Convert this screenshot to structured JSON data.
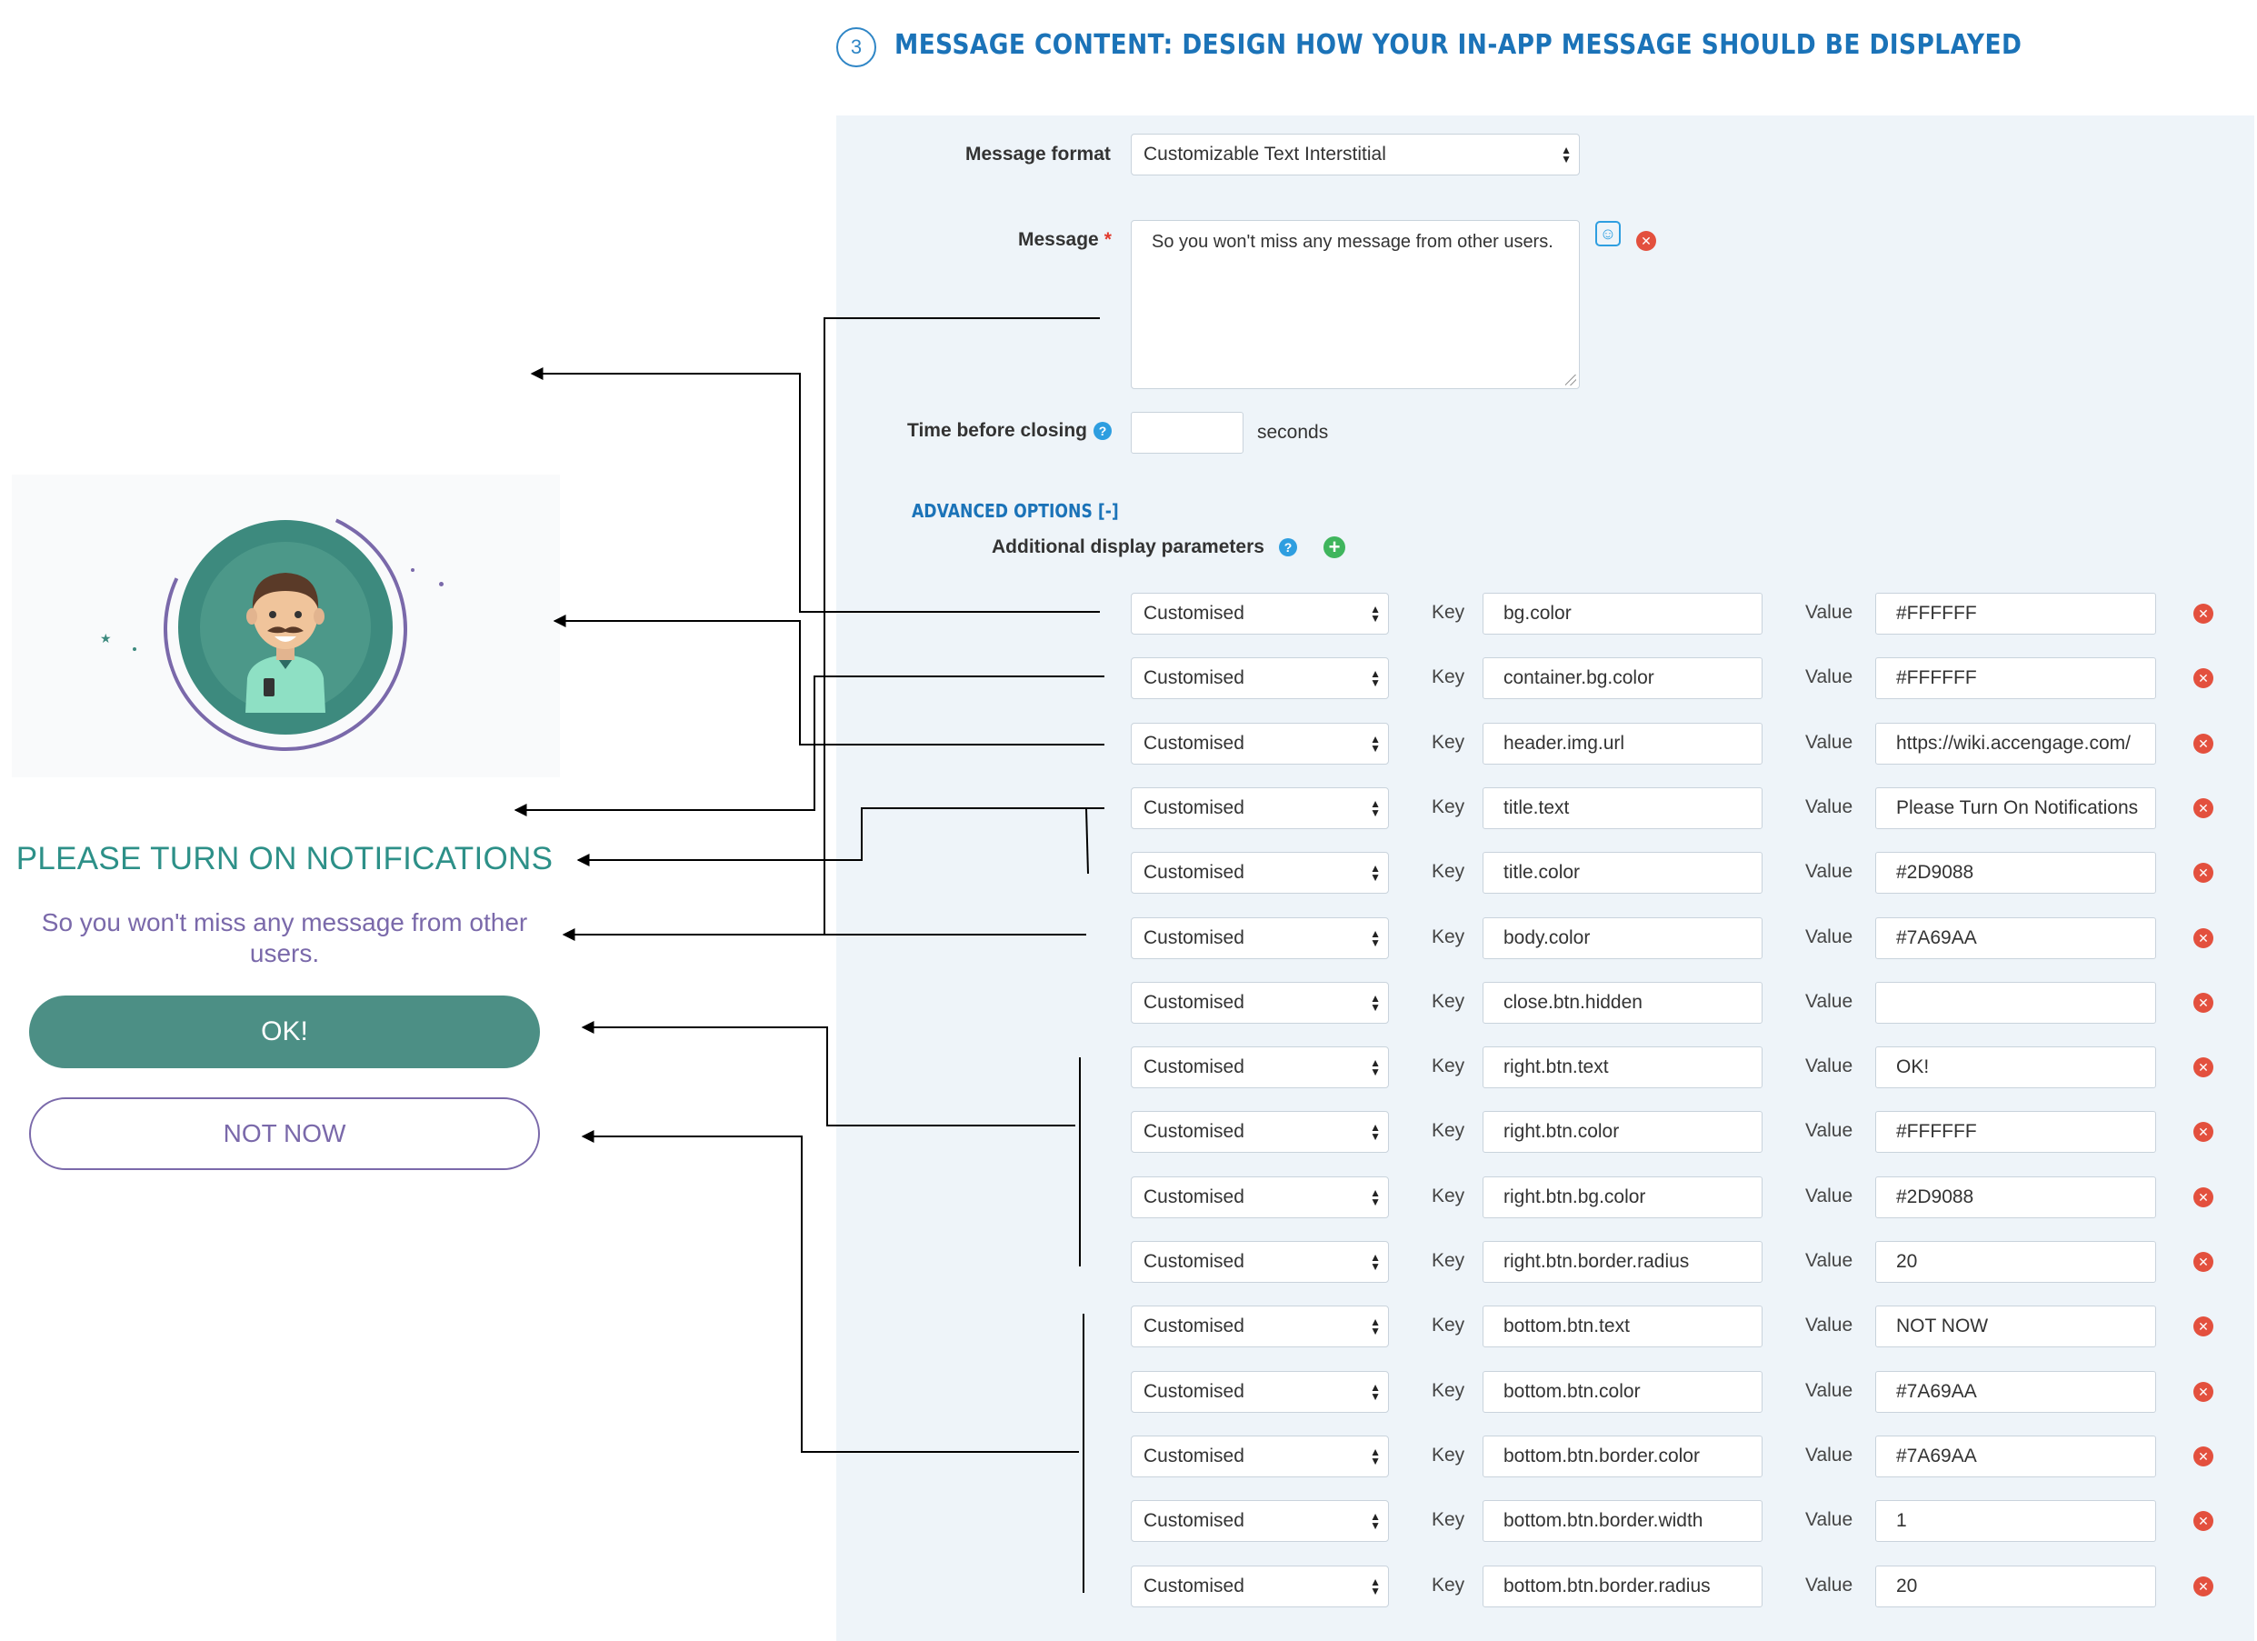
{
  "header": {
    "step_number": "3",
    "title": "MESSAGE CONTENT: DESIGN HOW YOUR IN-APP MESSAGE SHOULD BE DISPLAYED"
  },
  "form": {
    "message_format_label": "Message format",
    "message_format_value": "Customizable Text Interstitial",
    "message_label": "Message",
    "message_required_mark": "*",
    "message_value": "So you won't miss any message from other users.",
    "time_before_closing_label": "Time before closing",
    "time_before_closing_value": "",
    "seconds_label": "seconds",
    "advanced_options_link": "ADVANCED OPTIONS [-]",
    "additional_params_label": "Additional display parameters",
    "key_label": "Key",
    "value_label": "Value",
    "params": [
      {
        "type": "Customised",
        "key": "bg.color",
        "value": "#FFFFFF"
      },
      {
        "type": "Customised",
        "key": "container.bg.color",
        "value": "#FFFFFF"
      },
      {
        "type": "Customised",
        "key": "header.img.url",
        "value": "https://wiki.accengage.com/"
      },
      {
        "type": "Customised",
        "key": "title.text",
        "value": "Please Turn On Notifications"
      },
      {
        "type": "Customised",
        "key": "title.color",
        "value": "#2D9088"
      },
      {
        "type": "Customised",
        "key": "body.color",
        "value": "#7A69AA"
      },
      {
        "type": "Customised",
        "key": "close.btn.hidden",
        "value": ""
      },
      {
        "type": "Customised",
        "key": "right.btn.text",
        "value": "OK!"
      },
      {
        "type": "Customised",
        "key": "right.btn.color",
        "value": "#FFFFFF"
      },
      {
        "type": "Customised",
        "key": "right.btn.bg.color",
        "value": "#2D9088"
      },
      {
        "type": "Customised",
        "key": "right.btn.border.radius",
        "value": "20"
      },
      {
        "type": "Customised",
        "key": "bottom.btn.text",
        "value": "NOT NOW"
      },
      {
        "type": "Customised",
        "key": "bottom.btn.color",
        "value": "#7A69AA"
      },
      {
        "type": "Customised",
        "key": "bottom.btn.border.color",
        "value": "#7A69AA"
      },
      {
        "type": "Customised",
        "key": "bottom.btn.border.width",
        "value": "1"
      },
      {
        "type": "Customised",
        "key": "bottom.btn.border.radius",
        "value": "20"
      }
    ]
  },
  "preview": {
    "title": "PLEASE TURN ON NOTIFICATIONS",
    "body": "So you won't miss any message from other users.",
    "ok_button": "OK!",
    "not_now_button": "NOT NOW"
  },
  "colors": {
    "accent_blue": "#1b73b8",
    "title_color": "#2D9088",
    "body_color": "#7A69AA",
    "ok_button_bg": "#4c8f85",
    "panel_bg": "#eef4f9"
  },
  "icons": [
    "help-icon",
    "add-icon",
    "remove-icon",
    "emoji-icon"
  ]
}
